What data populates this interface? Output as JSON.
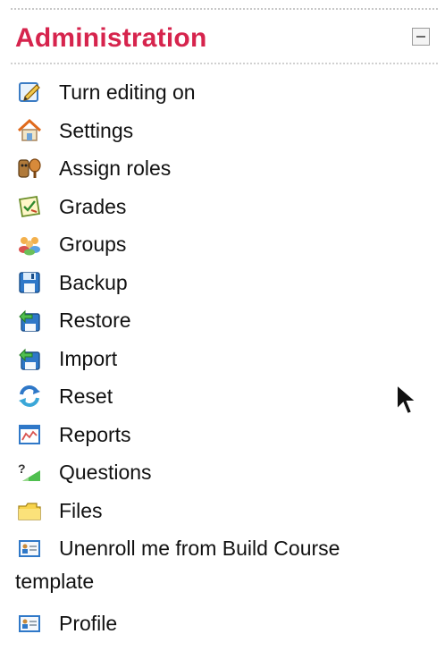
{
  "block": {
    "title": "Administration",
    "accent_color": "#d6244d",
    "collapse_icon": "minus-box-icon"
  },
  "menu": [
    {
      "label": "Turn editing on",
      "icon": "edit-pencil-icon"
    },
    {
      "label": "Settings",
      "icon": "settings-icon"
    },
    {
      "label": "Assign roles",
      "icon": "assign-roles-icon"
    },
    {
      "label": "Grades",
      "icon": "grades-icon"
    },
    {
      "label": "Groups",
      "icon": "groups-icon"
    },
    {
      "label": "Backup",
      "icon": "backup-icon"
    },
    {
      "label": "Restore",
      "icon": "restore-icon"
    },
    {
      "label": "Import",
      "icon": "import-icon"
    },
    {
      "label": "Reset",
      "icon": "reset-icon"
    },
    {
      "label": "Reports",
      "icon": "reports-icon"
    },
    {
      "label": "Questions",
      "icon": "questions-icon"
    },
    {
      "label": "Files",
      "icon": "folder-icon"
    },
    {
      "label": "Unenroll me from Build Course",
      "label_line2": "template",
      "icon": "user-card-icon"
    },
    {
      "label": "Profile",
      "icon": "user-card-icon"
    }
  ]
}
